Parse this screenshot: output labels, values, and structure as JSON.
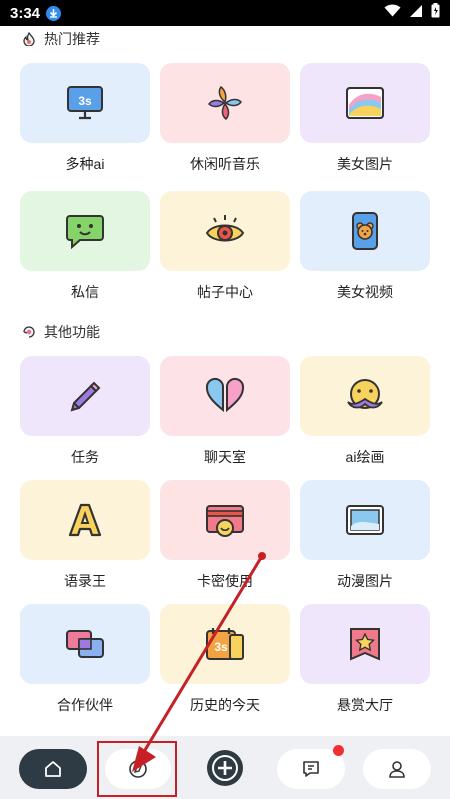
{
  "status_bar": {
    "time": "3:34"
  },
  "sections": [
    {
      "title": "热门推荐",
      "items": [
        {
          "label": "多种ai",
          "icon": "monitor-3s-icon",
          "bg": "#e3eefc"
        },
        {
          "label": "休闲听音乐",
          "icon": "pinwheel-icon",
          "bg": "#fde3e3"
        },
        {
          "label": "美女图片",
          "icon": "rainbow-picture-icon",
          "bg": "#efe6fb"
        },
        {
          "label": "私信",
          "icon": "chat-bubble-face-icon",
          "bg": "#e2f6e1"
        },
        {
          "label": "帖子中心",
          "icon": "eye-icon",
          "bg": "#fdf3d9"
        },
        {
          "label": "美女视频",
          "icon": "phone-bear-icon",
          "bg": "#e3eefc"
        }
      ]
    },
    {
      "title": "其他功能",
      "items": [
        {
          "label": "任务",
          "icon": "pencil-icon",
          "bg": "#efe6fb"
        },
        {
          "label": "聊天室",
          "icon": "split-heart-icon",
          "bg": "#fde3e8"
        },
        {
          "label": "ai绘画",
          "icon": "mustache-face-icon",
          "bg": "#fdf3d9"
        },
        {
          "label": "语录王",
          "icon": "letter-a-icon",
          "bg": "#fdf3d9"
        },
        {
          "label": "卡密使用",
          "icon": "card-smile-icon",
          "bg": "#fde3e3"
        },
        {
          "label": "动漫图片",
          "icon": "landscape-picture-icon",
          "bg": "#e3eefc"
        },
        {
          "label": "合作伙伴",
          "icon": "overlapping-cards-icon",
          "bg": "#e3eefc"
        },
        {
          "label": "历史的今天",
          "icon": "calendar-3s-icon",
          "bg": "#fdf3d9"
        },
        {
          "label": "悬赏大厅",
          "icon": "star-banner-icon",
          "bg": "#efe6fb"
        }
      ]
    }
  ],
  "bottom_nav": [
    {
      "name": "home",
      "icon": "home-icon"
    },
    {
      "name": "discover",
      "icon": "compass-icon"
    },
    {
      "name": "add",
      "icon": "plus-circle-icon"
    },
    {
      "name": "messages",
      "icon": "message-icon",
      "badge": true
    },
    {
      "name": "profile",
      "icon": "user-icon"
    }
  ],
  "colors": {
    "nav_bg": "#eef0f3",
    "home_active": "#2e3a44",
    "badge_red": "#f03030",
    "annotation_red": "#c62026"
  }
}
